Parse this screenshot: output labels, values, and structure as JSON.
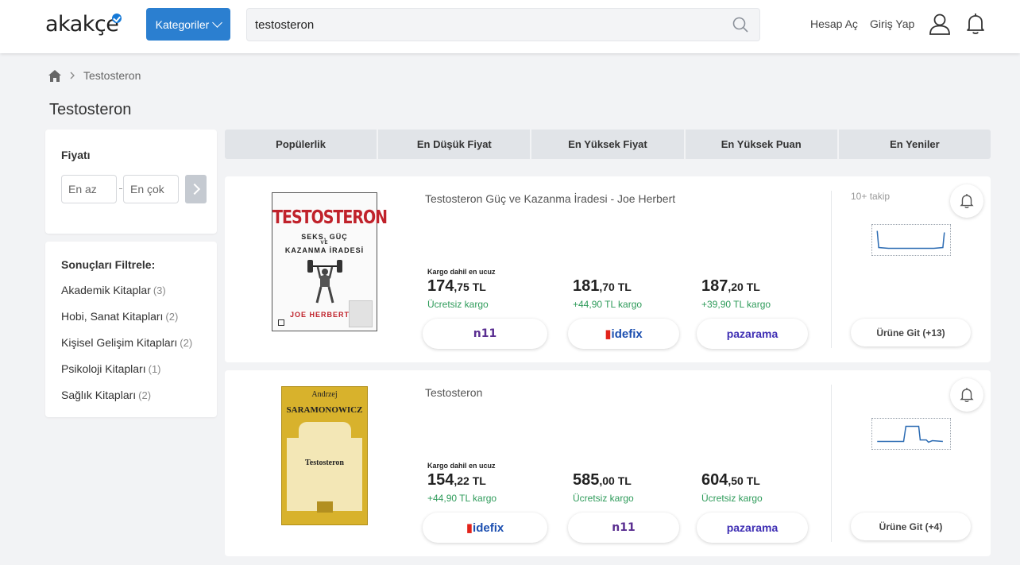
{
  "header": {
    "logo": "akakçe",
    "categories_label": "Kategoriler",
    "search_value": "testosteron",
    "signup_label": "Hesap Aç",
    "login_label": "Giriş Yap"
  },
  "breadcrumb": {
    "current": "Testosteron"
  },
  "page_title": "Testosteron",
  "price_filter": {
    "title": "Fiyatı",
    "min_placeholder": "En az",
    "max_placeholder": "En çok"
  },
  "filters": {
    "title": "Sonuçları Filtrele:",
    "items": [
      {
        "label": "Akademik Kitaplar",
        "count": "(3)"
      },
      {
        "label": "Hobi, Sanat Kitapları",
        "count": "(2)"
      },
      {
        "label": "Kişisel Gelişim Kitapları",
        "count": "(2)"
      },
      {
        "label": "Psikoloji Kitapları",
        "count": "(1)"
      },
      {
        "label": "Sağlık Kitapları",
        "count": "(2)"
      }
    ]
  },
  "sort_tabs": [
    "Popülerlik",
    "En Düşük Fiyat",
    "En Yüksek Fiyat",
    "En Yüksek Puan",
    "En Yeniler"
  ],
  "products": [
    {
      "name": "Testosteron Güç ve Kazanma İradesi - Joe Herbert",
      "follow": "10+ takip",
      "cover": {
        "title": "TESTOSTERON",
        "subtitle1": "SEKS, GÜÇ",
        "subtitle2": "VE",
        "subtitle3": "KAZANMA İRADESİ",
        "author": "JOE HERBERT"
      },
      "cheapest_label": "Kargo dahil en ucuz",
      "offers": [
        {
          "price_main": "174",
          "price_dec": ",75 TL",
          "shipping": "Ücretsiz kargo",
          "store": "n11"
        },
        {
          "price_main": "181",
          "price_dec": ",70 TL",
          "shipping": "+44,90 TL kargo",
          "store": "idefix"
        },
        {
          "price_main": "187",
          "price_dec": ",20 TL",
          "shipping": "+39,90 TL kargo",
          "store": "pazarama"
        }
      ],
      "go_label": "Ürüne Git (+13)"
    },
    {
      "name": "Testosteron",
      "cover": {
        "author_first": "Andrzej",
        "author_last": "SARAMONOWICZ",
        "title": "Testosteron"
      },
      "cheapest_label": "Kargo dahil en ucuz",
      "offers": [
        {
          "price_main": "154",
          "price_dec": ",22 TL",
          "shipping": "+44,90 TL kargo",
          "store": "idefix"
        },
        {
          "price_main": "585",
          "price_dec": ",00 TL",
          "shipping": "Ücretsiz kargo",
          "store": "n11"
        },
        {
          "price_main": "604",
          "price_dec": ",50 TL",
          "shipping": "Ücretsiz kargo",
          "store": "pazarama"
        }
      ],
      "go_label": "Ürüne Git (+4)"
    }
  ],
  "colors": {
    "accent": "#2b7fd0",
    "shipping_green": "#2e9b5a",
    "n11_purple": "#5a2e91",
    "idefix_blue": "#1c4fb0",
    "pazarama_purple": "#3f2fb4",
    "cover_red": "#c0222b",
    "cover_yellow": "#d8b22c"
  }
}
